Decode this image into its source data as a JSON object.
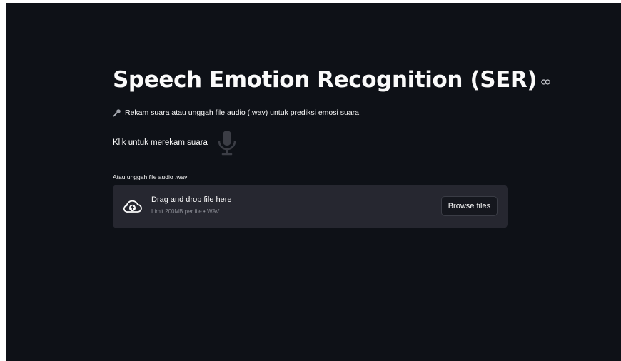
{
  "header": {
    "title": "Speech Emotion Recognition (SER)"
  },
  "intro": {
    "text": "Rekam suara atau unggah file audio (.wav) untuk prediksi emosi suara."
  },
  "recorder": {
    "label": "Klik untuk merekam suara"
  },
  "uploader": {
    "label": "Atau unggah file audio .wav",
    "drop_title": "Drag and drop file here",
    "drop_hint": "Limit 200MB per file • WAV",
    "browse_label": "Browse files"
  },
  "icons": {
    "anchor": "link-icon",
    "intro": "microphone-emoji-icon",
    "record": "microphone-icon",
    "upload": "cloud-upload-icon"
  },
  "colors": {
    "background": "#0e1117",
    "surface": "#262730",
    "text": "#fafafa",
    "muted": "#8b8d95"
  }
}
